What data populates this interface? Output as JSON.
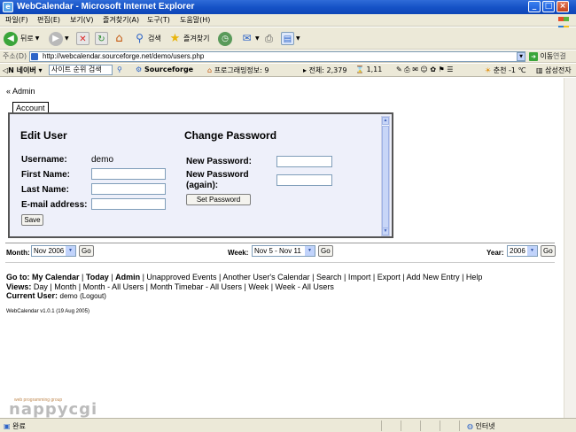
{
  "window": {
    "title": "WebCalendar - Microsoft Internet Explorer",
    "icon": "ie-icon"
  },
  "menubar": {
    "items": [
      "파일(F)",
      "편집(E)",
      "보기(V)",
      "즐겨찾기(A)",
      "도구(T)",
      "도움말(H)"
    ]
  },
  "toolbar": {
    "back_label": "뒤로",
    "search_label": "검색",
    "favorites_label": "즐겨찾기"
  },
  "address": {
    "label": "주소(D)",
    "url": "http://webcalendar.sourceforge.net/demo/users.php",
    "go_label": "이동",
    "links_label": "연결"
  },
  "naverbar": {
    "search_value": "사이트 순위 검색",
    "sourceforge": "Sourceforge",
    "program_info": "프로그래밍정보: 9",
    "total": "전체: 2,379",
    "counter": "1,11",
    "weather": "춘천 -1 ℃",
    "samsung": "삼성전자"
  },
  "page": {
    "admin_link": "« Admin",
    "tab_account": "Account",
    "edit_user": {
      "heading": "Edit User",
      "username_label": "Username:",
      "username_value": "demo",
      "first_name_label": "First Name:",
      "last_name_label": "Last Name:",
      "email_label": "E-mail address:",
      "save_label": "Save"
    },
    "change_password": {
      "heading": "Change Password",
      "new_password_label": "New Password:",
      "new_password_again_label_1": "New Password",
      "new_password_again_label_2": "(again):",
      "set_password_label": "Set Password"
    },
    "nav": {
      "month_label": "Month:",
      "month_value": "Nov 2006",
      "week_label": "Week:",
      "week_value": "Nov 5 - Nov 11",
      "year_label": "Year:",
      "year_value": "2006",
      "go_label": "Go"
    },
    "goto": {
      "label": "Go to:",
      "my_calendar": "My Calendar",
      "today": "Today",
      "admin": "Admin",
      "links": [
        "Unapproved Events",
        "Another User's Calendar",
        "Search",
        "Import",
        "Export",
        "Add New Entry",
        "Help"
      ]
    },
    "views": {
      "label": "Views:",
      "links": [
        "Day",
        "Month",
        "Month - All Users",
        "Month Timebar - All Users",
        "Week",
        "Week - All Users"
      ]
    },
    "current_user": {
      "label": "Current User:",
      "value": "demo",
      "logout": "(Logout)"
    },
    "version": "WebCalendar v1.0.1 (19 Aug 2005)"
  },
  "watermark": {
    "text": "nappycgi",
    "sub": "web programming group"
  },
  "statusbar": {
    "status": "완료",
    "zone": "인터넷"
  }
}
